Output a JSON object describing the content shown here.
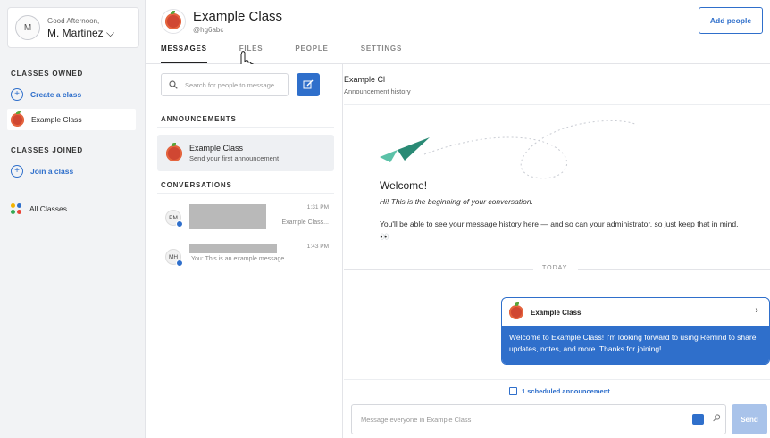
{
  "colors": {
    "accent": "#2f6fcb",
    "sidebar_bg": "#f2f3f5",
    "apple_red": "#d04732",
    "leaf_green": "#5aa43a"
  },
  "user": {
    "greeting": "Good Afternoon,",
    "name": "M. Martinez",
    "initial": "M"
  },
  "sidebar": {
    "owned_heading": "CLASSES OWNED",
    "create_label": "Create a class",
    "owned_classes": [
      "Example Class"
    ],
    "joined_heading": "CLASSES JOINED",
    "join_label": "Join a class",
    "all_classes_label": "All Classes"
  },
  "header": {
    "class_name": "Example Class",
    "handle": "@hg6abc",
    "tabs": [
      "MESSAGES",
      "FILES",
      "PEOPLE",
      "SETTINGS"
    ],
    "active_tab": "MESSAGES",
    "add_people_label": "Add people"
  },
  "middle": {
    "search_placeholder": "Search for people to message",
    "announcements_heading": "ANNOUNCEMENTS",
    "announcement": {
      "title": "Example Class",
      "subtitle": "Send your first announcement"
    },
    "conversations_heading": "CONVERSATIONS",
    "conversations": [
      {
        "initials": "PM",
        "time": "1:31 PM",
        "preview": "Example Class..."
      },
      {
        "initials": "MH",
        "time": "1:43 PM",
        "preview": "You: This is an example message."
      }
    ]
  },
  "conversation": {
    "title": "Example Cl",
    "subtitle": "Announcement history",
    "welcome_title": "Welcome!",
    "welcome_italic": "Hi! This is the beginning of your conversation.",
    "welcome_info": "You'll be able to see your message history here — and so can your administrator, so just keep that in mind. 👀",
    "day_divider": "TODAY",
    "message_card": {
      "sender": "Example Class",
      "body": "Welcome to Example Class! I'm looking forward to using Remind to share updates, notes, and more. Thanks for joining!"
    },
    "scheduled_label": "1 scheduled announcement",
    "composer_placeholder": "Message everyone in Example Class",
    "send_label": "Send"
  }
}
